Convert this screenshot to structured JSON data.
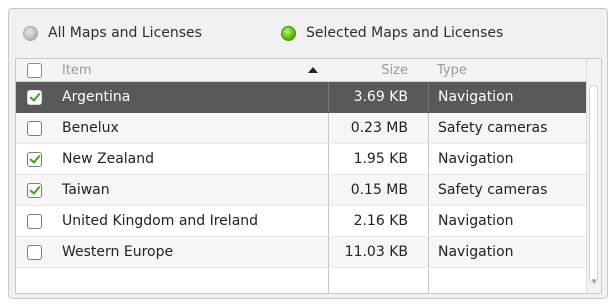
{
  "filters": {
    "all_label": "All Maps and Licenses",
    "selected_label": "Selected Maps and Licenses",
    "active": "selected"
  },
  "table": {
    "headers": {
      "item": "Item",
      "size": "Size",
      "type": "Type"
    },
    "sort": {
      "column": "item",
      "direction": "ascending"
    },
    "rows": [
      {
        "checked": true,
        "item": "Argentina",
        "size": "3.69 KB",
        "type": "Navigation",
        "selected": true
      },
      {
        "checked": false,
        "item": "Benelux",
        "size": "0.23 MB",
        "type": "Safety cameras",
        "selected": false
      },
      {
        "checked": true,
        "item": "New Zealand",
        "size": "1.95 KB",
        "type": "Navigation",
        "selected": false
      },
      {
        "checked": true,
        "item": "Taiwan",
        "size": "0.15 MB",
        "type": "Safety cameras",
        "selected": false
      },
      {
        "checked": false,
        "item": "United Kingdom and Ireland",
        "size": "2.16 KB",
        "type": "Navigation",
        "selected": false
      },
      {
        "checked": false,
        "item": "Western Europe",
        "size": "11.03 KB",
        "type": "Navigation",
        "selected": false
      }
    ]
  },
  "colors": {
    "selected_row": "#595959",
    "check_green": "#3aa516",
    "radio_active": "#5fc012"
  }
}
